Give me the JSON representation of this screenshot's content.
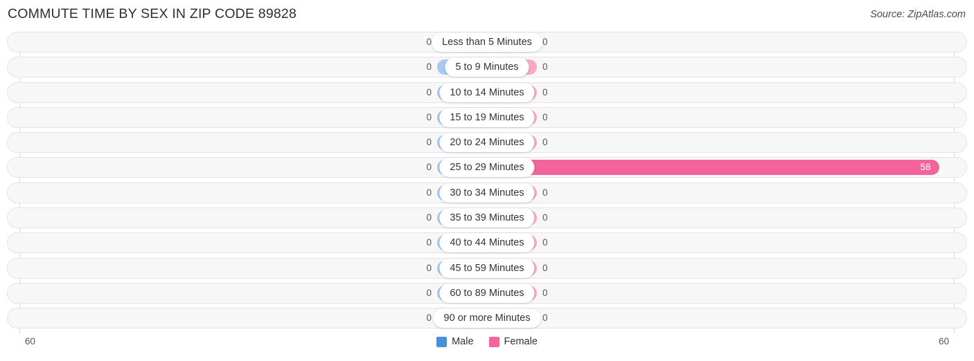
{
  "header": {
    "title": "COMMUTE TIME BY SEX IN ZIP CODE 89828",
    "source": "Source: ZipAtlas.com"
  },
  "footer": {
    "axis_left": "60",
    "axis_right": "60",
    "legend": [
      {
        "label": "Male",
        "color": "#4a90d9"
      },
      {
        "label": "Female",
        "color": "#f2649b"
      }
    ]
  },
  "colors": {
    "male_bar": "#a9c9ee",
    "female_bar": "#f8a8c3",
    "female_bar_highlight": "#f2649b",
    "male_legend": "#4a90d9",
    "female_legend": "#f2649b",
    "track_bg": "#f7f7f8",
    "track_border": "#e4e4e8"
  },
  "chart_data": {
    "type": "bar",
    "orientation": "horizontal-diverging",
    "title": "COMMUTE TIME BY SEX IN ZIP CODE 89828",
    "xlabel": "",
    "ylabel": "",
    "xlim": [
      60,
      60
    ],
    "axis_max": 60,
    "grid": false,
    "legend_position": "bottom-center",
    "categories": [
      "Less than 5 Minutes",
      "5 to 9 Minutes",
      "10 to 14 Minutes",
      "15 to 19 Minutes",
      "20 to 24 Minutes",
      "25 to 29 Minutes",
      "30 to 34 Minutes",
      "35 to 39 Minutes",
      "40 to 44 Minutes",
      "45 to 59 Minutes",
      "60 to 89 Minutes",
      "90 or more Minutes"
    ],
    "series": [
      {
        "name": "Male",
        "values": [
          0,
          0,
          0,
          0,
          0,
          0,
          0,
          0,
          0,
          0,
          0,
          0
        ]
      },
      {
        "name": "Female",
        "values": [
          0,
          0,
          0,
          0,
          0,
          58,
          0,
          0,
          0,
          0,
          0,
          0
        ]
      }
    ],
    "rows": [
      {
        "category": "Less than 5 Minutes",
        "male": 0,
        "female": 0,
        "male_label": "0",
        "female_label": "0"
      },
      {
        "category": "5 to 9 Minutes",
        "male": 0,
        "female": 0,
        "male_label": "0",
        "female_label": "0"
      },
      {
        "category": "10 to 14 Minutes",
        "male": 0,
        "female": 0,
        "male_label": "0",
        "female_label": "0"
      },
      {
        "category": "15 to 19 Minutes",
        "male": 0,
        "female": 0,
        "male_label": "0",
        "female_label": "0"
      },
      {
        "category": "20 to 24 Minutes",
        "male": 0,
        "female": 0,
        "male_label": "0",
        "female_label": "0"
      },
      {
        "category": "25 to 29 Minutes",
        "male": 0,
        "female": 58,
        "male_label": "0",
        "female_label": "58"
      },
      {
        "category": "30 to 34 Minutes",
        "male": 0,
        "female": 0,
        "male_label": "0",
        "female_label": "0"
      },
      {
        "category": "35 to 39 Minutes",
        "male": 0,
        "female": 0,
        "male_label": "0",
        "female_label": "0"
      },
      {
        "category": "40 to 44 Minutes",
        "male": 0,
        "female": 0,
        "male_label": "0",
        "female_label": "0"
      },
      {
        "category": "45 to 59 Minutes",
        "male": 0,
        "female": 0,
        "male_label": "0",
        "female_label": "0"
      },
      {
        "category": "60 to 89 Minutes",
        "male": 0,
        "female": 0,
        "male_label": "0",
        "female_label": "0"
      },
      {
        "category": "90 or more Minutes",
        "male": 0,
        "female": 0,
        "male_label": "0",
        "female_label": "0"
      }
    ]
  }
}
